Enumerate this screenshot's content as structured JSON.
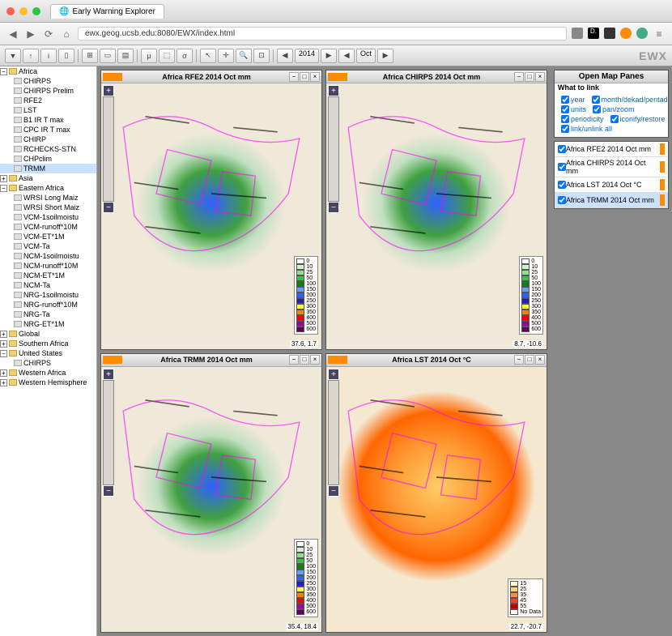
{
  "browser": {
    "tab_title": "Early Warning Explorer",
    "url": "ewx.geog.ucsb.edu:8080/EWX/index.html"
  },
  "toolbar": {
    "year": "2014",
    "period": "Oct",
    "logo": "EWX"
  },
  "tree": {
    "regions": [
      {
        "name": "Africa",
        "expanded": true,
        "children": [
          {
            "name": "CHIRPS"
          },
          {
            "name": "CHIRPS Prelim"
          },
          {
            "name": "RFE2"
          },
          {
            "name": "LST"
          },
          {
            "name": "B1 IR T max"
          },
          {
            "name": "CPC IR T max"
          },
          {
            "name": "CHIRP"
          },
          {
            "name": "RCHECKS-STN"
          },
          {
            "name": "CHPclim"
          },
          {
            "name": "TRMM",
            "selected": true
          }
        ]
      },
      {
        "name": "Asia",
        "expanded": false
      },
      {
        "name": "Eastern Africa",
        "expanded": true,
        "children": [
          {
            "name": "WRSI Long Maiz"
          },
          {
            "name": "WRSI Short Maiz"
          },
          {
            "name": "VCM-1soilmoistu"
          },
          {
            "name": "VCM-runoff*10M"
          },
          {
            "name": "VCM-ET*1M"
          },
          {
            "name": "VCM-Ta"
          },
          {
            "name": "NCM-1soilmoistu"
          },
          {
            "name": "NCM-runoff*10M"
          },
          {
            "name": "NCM-ET*1M"
          },
          {
            "name": "NCM-Ta"
          },
          {
            "name": "NRG-1soilmoistu"
          },
          {
            "name": "NRG-runoff*10M"
          },
          {
            "name": "NRG-Ta"
          },
          {
            "name": "NRG-ET*1M"
          }
        ]
      },
      {
        "name": "Global",
        "expanded": false
      },
      {
        "name": "Southern Africa",
        "expanded": false
      },
      {
        "name": "United States",
        "expanded": true,
        "children": [
          {
            "name": "CHIRPS"
          }
        ]
      },
      {
        "name": "Western Africa",
        "expanded": false
      },
      {
        "name": "Western Hemisphere",
        "expanded": false
      }
    ]
  },
  "maps": [
    {
      "title": "Africa RFE2 2014 Oct mm",
      "coords": "37.6, 1.7",
      "type": "rain"
    },
    {
      "title": "Africa CHIRPS 2014 Oct mm",
      "coords": "8.7, -10.6",
      "type": "rain"
    },
    {
      "title": "Africa TRMM 2014 Oct mm",
      "coords": "35.4, 18.4",
      "type": "rain"
    },
    {
      "title": "Africa LST 2014 Oct °C",
      "coords": "22.7, -20.7",
      "type": "lst"
    }
  ],
  "legend_rain": [
    {
      "v": "0",
      "c": "#ffffff"
    },
    {
      "v": "10",
      "c": "#d0f0d0"
    },
    {
      "v": "25",
      "c": "#90e090"
    },
    {
      "v": "50",
      "c": "#40c040"
    },
    {
      "v": "100",
      "c": "#108010"
    },
    {
      "v": "150",
      "c": "#60a0ff"
    },
    {
      "v": "200",
      "c": "#3060ff"
    },
    {
      "v": "250",
      "c": "#2020c0"
    },
    {
      "v": "300",
      "c": "#ffff40"
    },
    {
      "v": "350",
      "c": "#ff8000"
    },
    {
      "v": "400",
      "c": "#ff0000"
    },
    {
      "v": "500",
      "c": "#a000a0"
    },
    {
      "v": "600",
      "c": "#600060"
    }
  ],
  "legend_lst": [
    {
      "v": "15",
      "c": "#ffffcc"
    },
    {
      "v": "25",
      "c": "#ffd080"
    },
    {
      "v": "35",
      "c": "#ff9040"
    },
    {
      "v": "45",
      "c": "#ff4020"
    },
    {
      "v": "55",
      "c": "#c00000"
    },
    {
      "v": "No Data",
      "c": "#ffffff"
    }
  ],
  "right": {
    "title": "Open Map Panes",
    "what_to_link": "What to link",
    "opts": [
      {
        "l": "year",
        "c": true
      },
      {
        "l": "month/dekad/pentad",
        "c": true
      },
      {
        "l": "units",
        "c": true
      },
      {
        "l": "pan/zoom",
        "c": true
      },
      {
        "l": "periodicity",
        "c": true
      },
      {
        "l": "iconify/restore",
        "c": true
      },
      {
        "l": "link/unlink all",
        "c": true
      }
    ],
    "panes": [
      {
        "l": "Africa RFE2 2014 Oct mm",
        "sel": false
      },
      {
        "l": "Africa CHIRPS 2014 Oct mm",
        "sel": false
      },
      {
        "l": "Africa LST 2014 Oct °C",
        "sel": false
      },
      {
        "l": "Africa TRMM 2014 Oct mm",
        "sel": true
      }
    ]
  }
}
